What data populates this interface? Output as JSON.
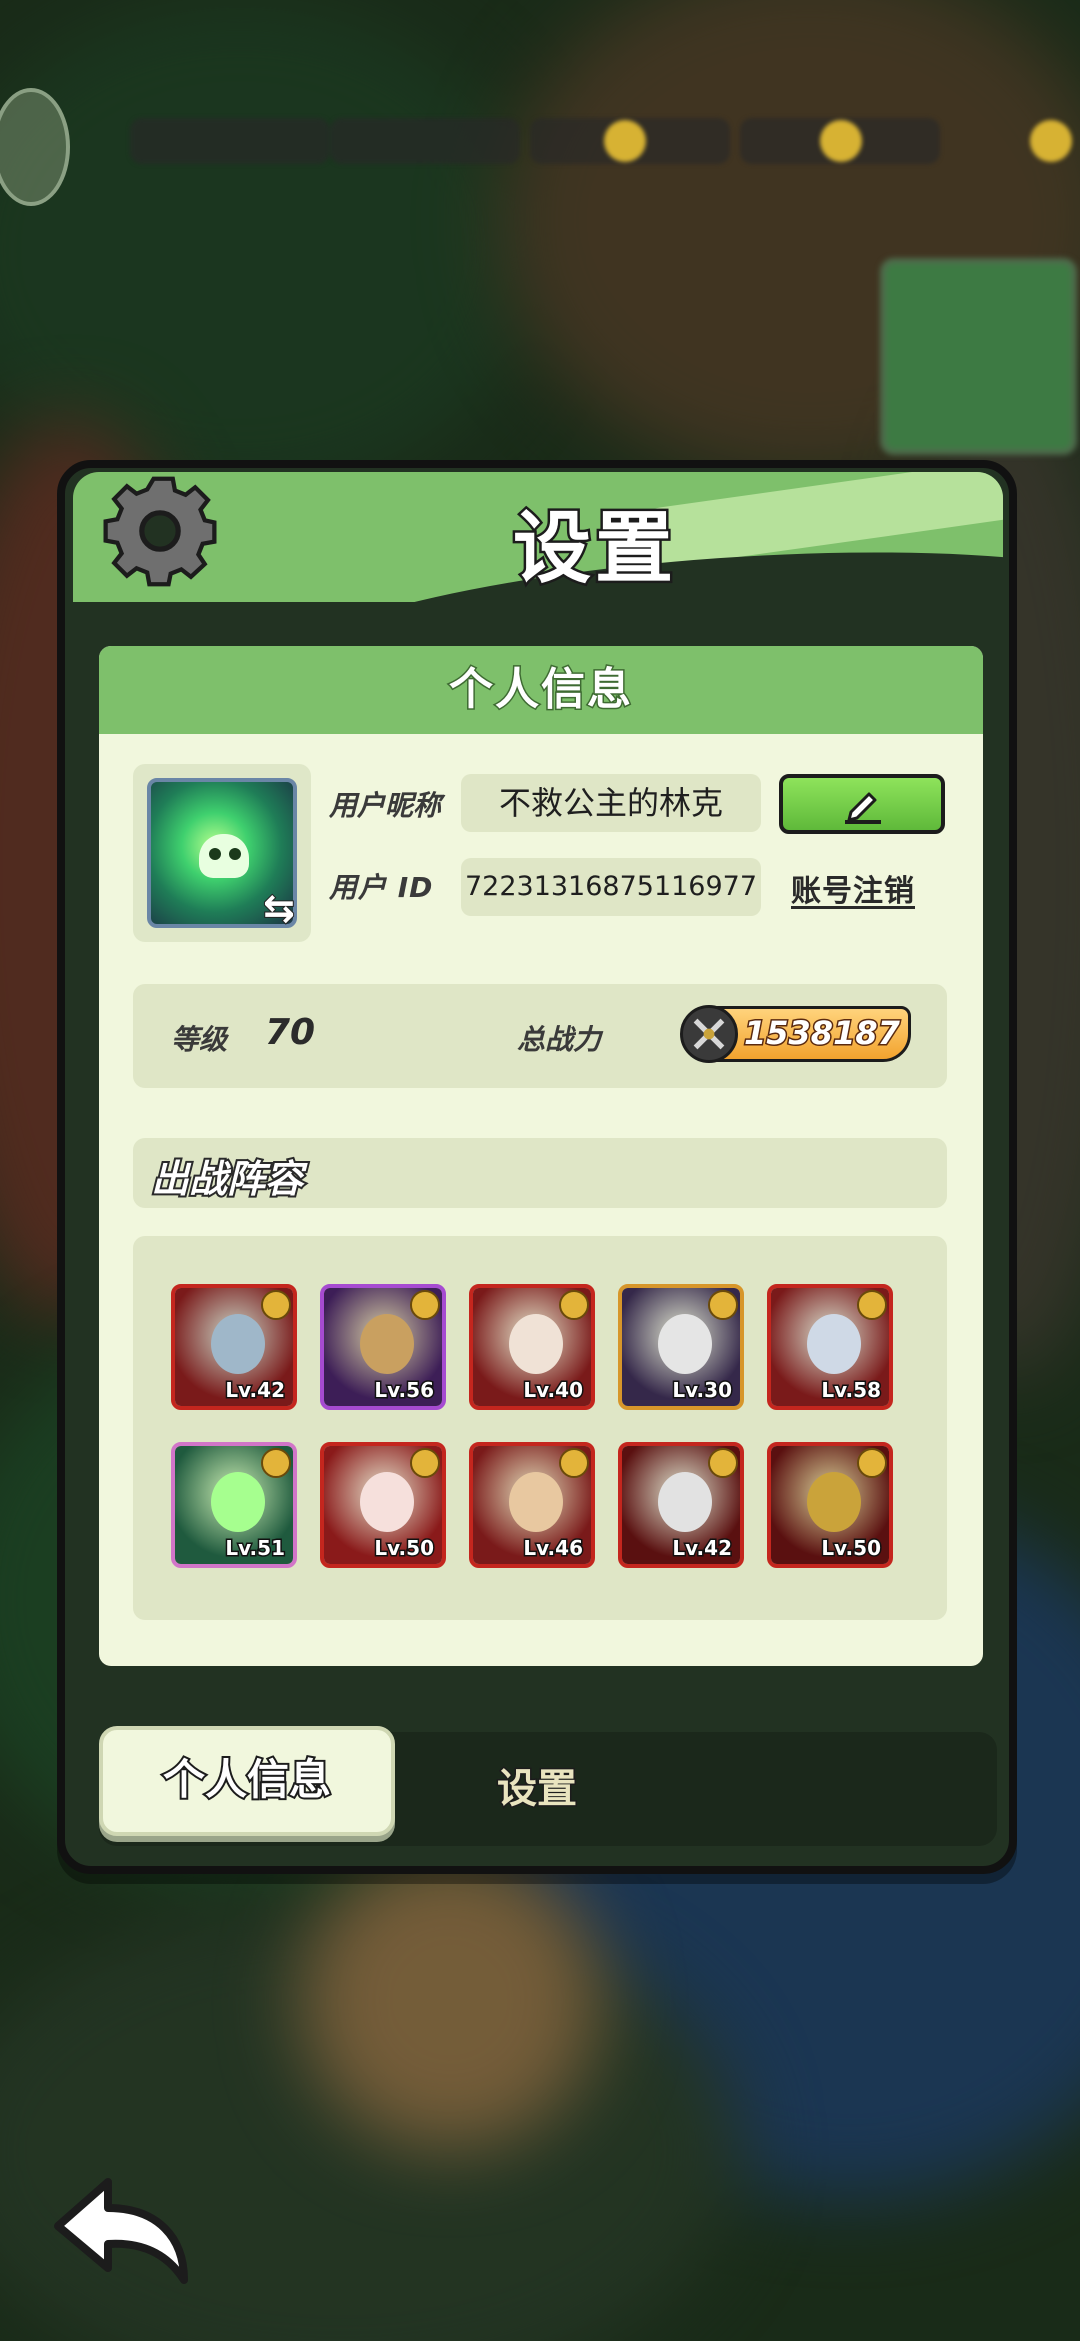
{
  "dialog": {
    "title": "设置",
    "panel_title": "个人信息"
  },
  "profile": {
    "nickname_label": "用户昵称",
    "nickname": "不救公主的林克",
    "id_label": "用户  ID",
    "user_id": "72231316875116977",
    "deregister_label": "账号注销",
    "avatar_icon": "skull-spirit-icon",
    "switch_icon": "swap-arrows-icon",
    "edit_icon": "pencil-icon"
  },
  "stats": {
    "level_label": "等级",
    "level": "70",
    "power_label": "总战力",
    "power": "1538187",
    "power_icon": "crossed-swords-icon"
  },
  "lineup": {
    "title": "出战阵容",
    "heroes": [
      {
        "level": "Lv.42",
        "frame": "#c4261e",
        "bg": "#7a1a1a",
        "face": "#9fb7c9"
      },
      {
        "level": "Lv.56",
        "frame": "#a64bd1",
        "bg": "#3d1e57",
        "face": "#c9a060"
      },
      {
        "level": "Lv.40",
        "frame": "#c4261e",
        "bg": "#7a1a1a",
        "face": "#f0e2d6"
      },
      {
        "level": "Lv.30",
        "frame": "#d7962a",
        "bg": "#35284a",
        "face": "#e5e5e5"
      },
      {
        "level": "Lv.58",
        "frame": "#c4261e",
        "bg": "#7a1a1a",
        "face": "#cfd9e6"
      },
      {
        "level": "Lv.51",
        "frame": "#d175c8",
        "bg": "#1f5a3e",
        "face": "#a6ff8f"
      },
      {
        "level": "Lv.50",
        "frame": "#c4261e",
        "bg": "#8a1a1a",
        "face": "#f6e0dc"
      },
      {
        "level": "Lv.46",
        "frame": "#c4261e",
        "bg": "#7a1a1a",
        "face": "#e8c8a0"
      },
      {
        "level": "Lv.42",
        "frame": "#c4261e",
        "bg": "#5a1010",
        "face": "#e2e2e2"
      },
      {
        "level": "Lv.50",
        "frame": "#c4261e",
        "bg": "#5a1010",
        "face": "#caa33a"
      }
    ]
  },
  "tabs": [
    {
      "label": "个人信息",
      "active": true
    },
    {
      "label": "设置",
      "active": false
    }
  ],
  "icons": {
    "settings": "gear-icon",
    "back": "back-arrow-icon"
  },
  "colors": {
    "accent_green": "#7ec06b",
    "panel_bg": "#f1f7dd",
    "field_bg": "#dfe6c6",
    "power_gold": "#f2a32e",
    "hero_frame_red": "#c4261e"
  }
}
